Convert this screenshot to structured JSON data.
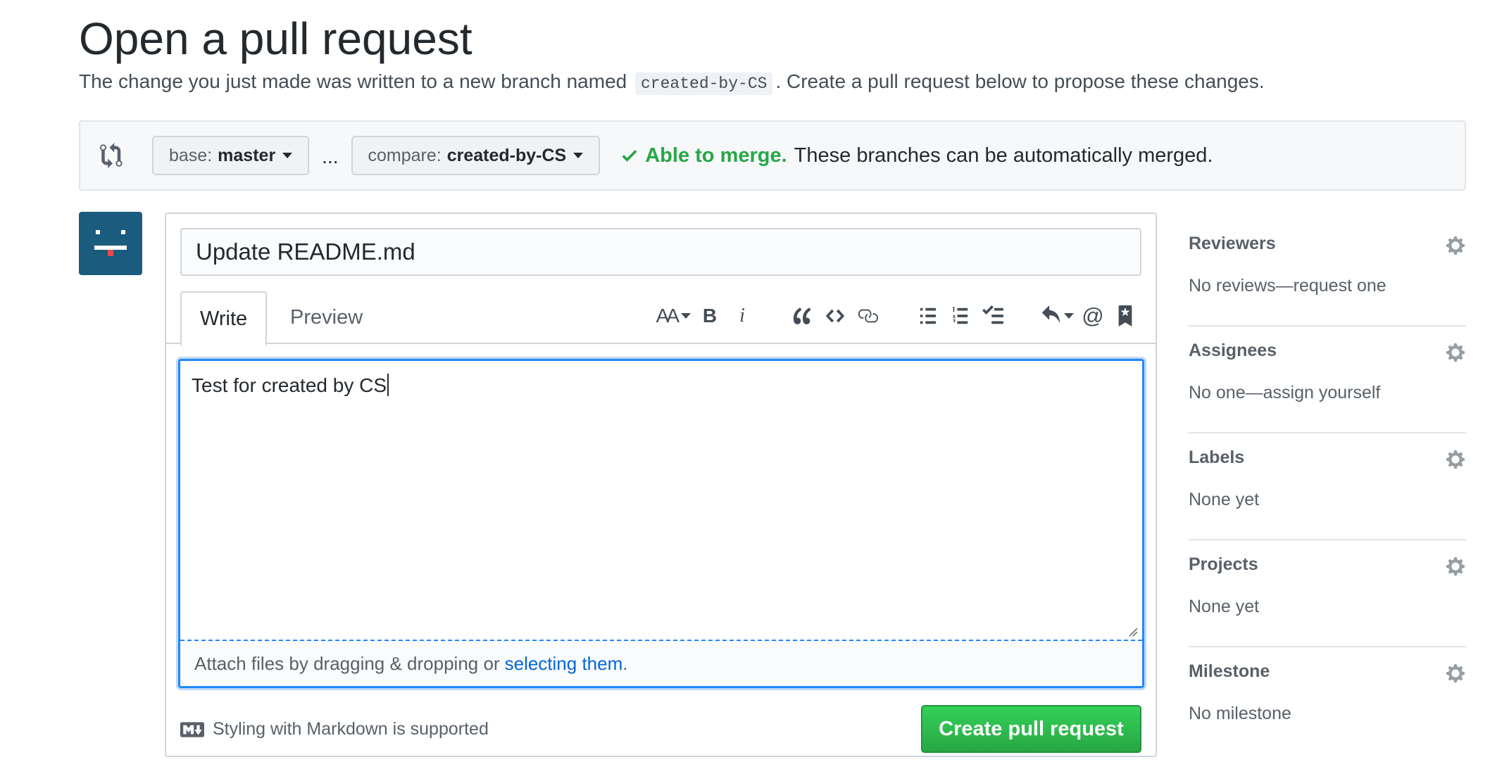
{
  "page": {
    "title": "Open a pull request",
    "subtitle_before": "The change you just made was written to a new branch named",
    "branch_name": "created-by-CS",
    "subtitle_after": ". Create a pull request below to propose these changes."
  },
  "compare_bar": {
    "base_prefix": "base:",
    "base_value": "master",
    "separator": "...",
    "compare_prefix": "compare:",
    "compare_value": "created-by-CS",
    "merge_ok": "Able to merge.",
    "merge_desc": "These branches can be automatically merged."
  },
  "form": {
    "title_value": "Update README.md",
    "tabs": [
      {
        "label": "Write"
      },
      {
        "label": "Preview"
      }
    ],
    "toolbar": {
      "header": "AA",
      "bold": "B",
      "italic": "i",
      "mention": "@"
    },
    "body_text": "Test for created by CS",
    "attach_text": "Attach files by dragging & dropping or",
    "attach_link": "selecting them",
    "attach_end": ".",
    "markdown_hint": "Styling with Markdown is supported",
    "submit_label": "Create pull request"
  },
  "sidebar": {
    "sections": [
      {
        "heading": "Reviewers",
        "value": "No reviews—request one"
      },
      {
        "heading": "Assignees",
        "value": "No one—assign yourself"
      },
      {
        "heading": "Labels",
        "value": "None yet"
      },
      {
        "heading": "Projects",
        "value": "None yet"
      },
      {
        "heading": "Milestone",
        "value": "No milestone"
      }
    ]
  },
  "colors": {
    "accent_green": "#28a745",
    "link_blue": "#0366d6",
    "focus_blue": "#2188ff",
    "avatar_bg": "#1b5c7e"
  }
}
